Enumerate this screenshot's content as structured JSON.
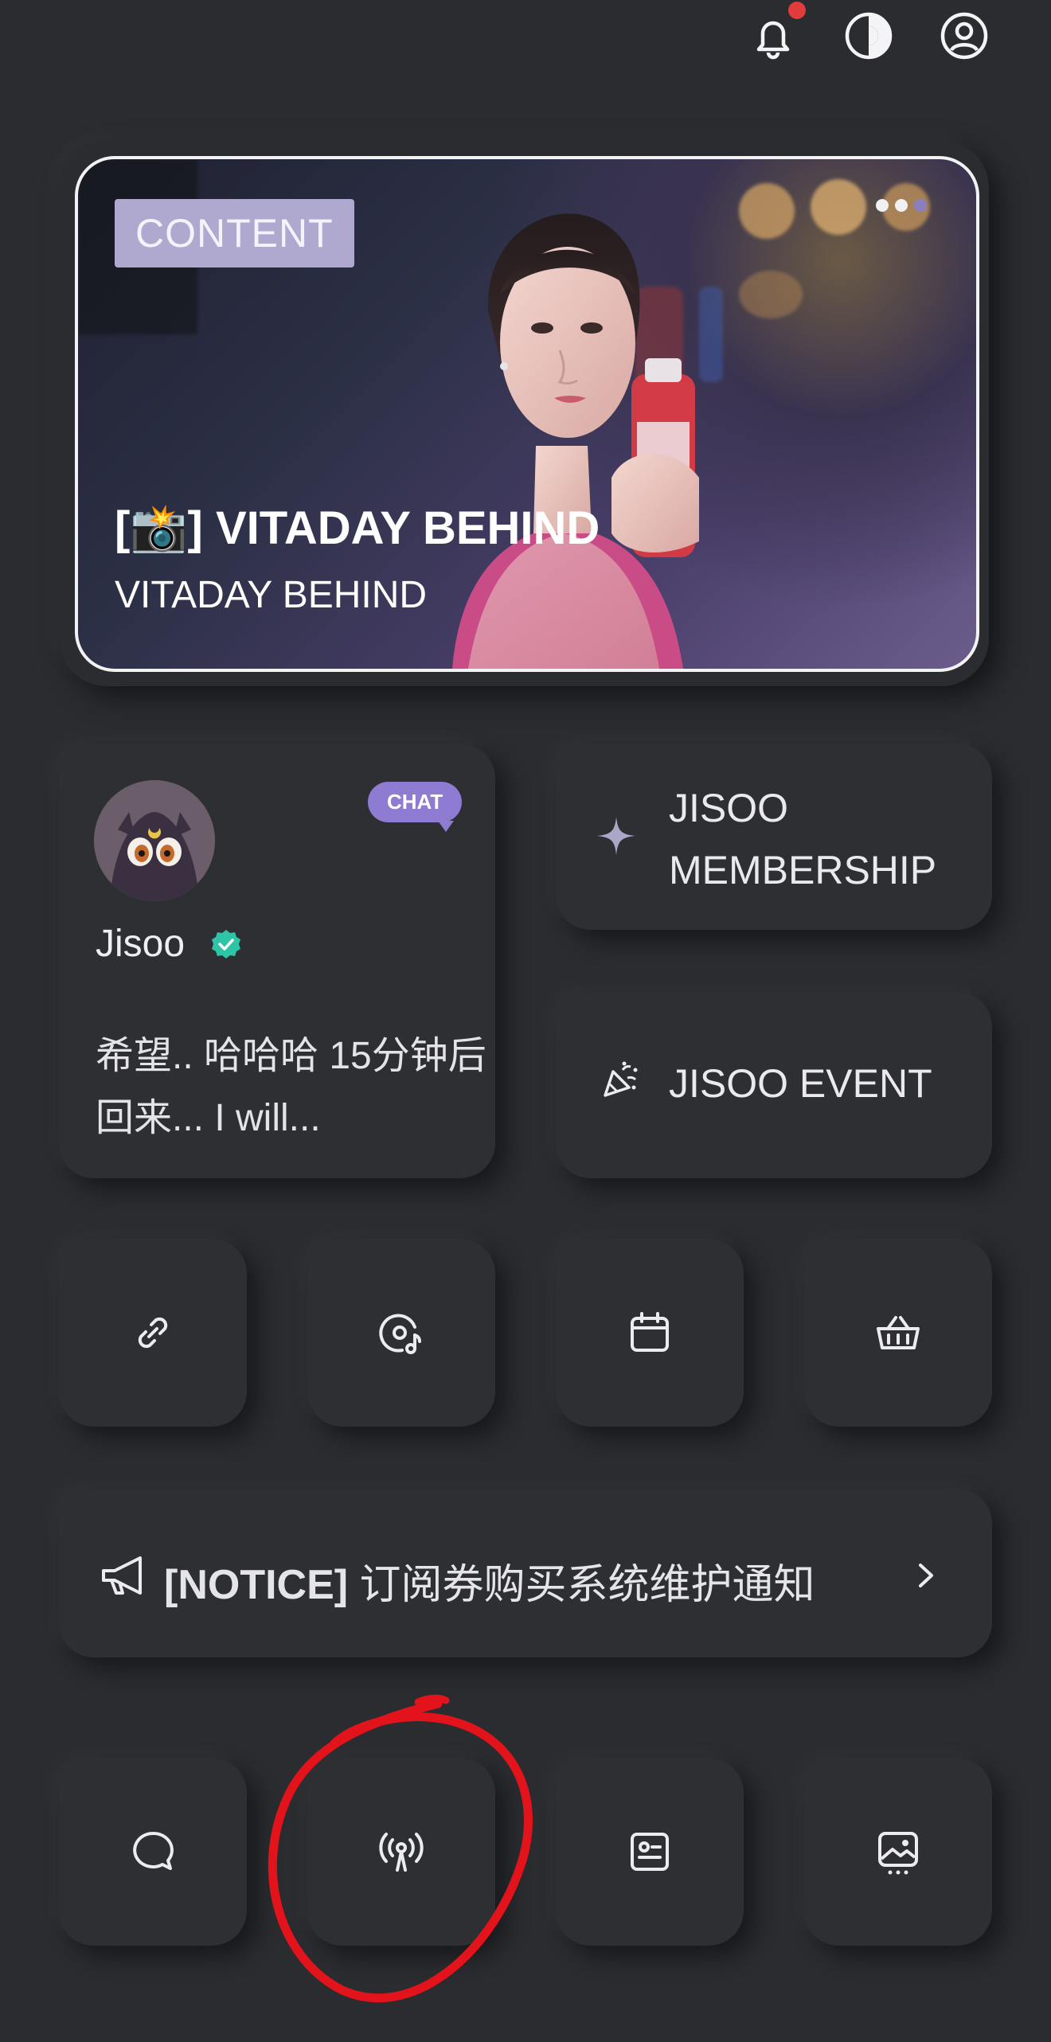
{
  "top_bar": {
    "icons": [
      "bell-icon",
      "theme-contrast-icon",
      "profile-icon"
    ],
    "notification_dot_color": "#e23b3b"
  },
  "hero": {
    "tag": "CONTENT",
    "title": "[📸] VITADAY BEHIND",
    "subtitle": "VITADAY BEHIND",
    "pager_count": 3,
    "pager_active_index": 2
  },
  "chat_card": {
    "badge": "CHAT",
    "name": "Jisoo",
    "message": "希望.. 哈哈哈 15分钟后回来... I will..."
  },
  "membership_button": {
    "line1": "JISOO",
    "line2": "MEMBERSHIP",
    "icon": "sparkle-icon"
  },
  "event_button": {
    "label": "JISOO EVENT",
    "icon": "party-popper-icon"
  },
  "quick_row_1": [
    {
      "icon": "link-icon"
    },
    {
      "icon": "music-disc-icon"
    },
    {
      "icon": "calendar-icon"
    },
    {
      "icon": "shopping-basket-icon"
    }
  ],
  "notice": {
    "prefix": "[NOTICE]",
    "text": " 订阅券购买系统维护通知",
    "icon": "megaphone-icon"
  },
  "quick_row_2": [
    {
      "icon": "chat-bubble-icon"
    },
    {
      "icon": "live-broadcast-icon"
    },
    {
      "icon": "profile-card-icon"
    },
    {
      "icon": "photo-gallery-icon"
    }
  ],
  "colors": {
    "background": "#2a2c30",
    "card": "#2d2f33",
    "accent_purple": "#8f7bd1",
    "verified_teal": "#2ec4a6",
    "annotation_red": "#e3131b"
  }
}
